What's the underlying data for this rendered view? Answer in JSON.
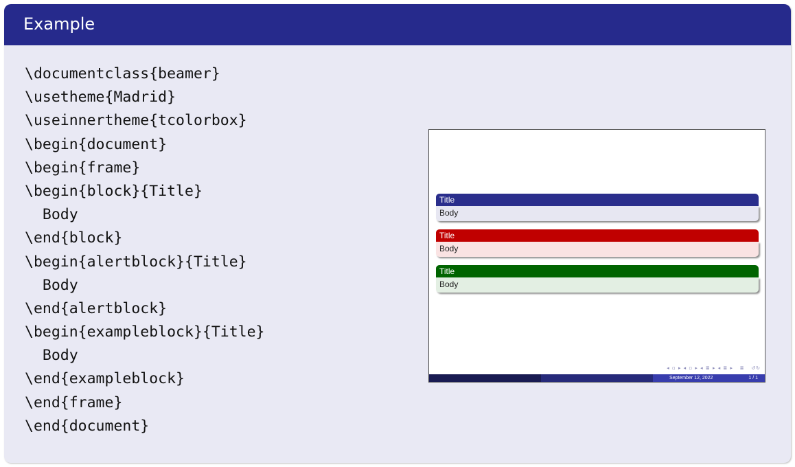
{
  "example": {
    "title": "Example"
  },
  "code_lines": [
    "\\documentclass{beamer}",
    "\\usetheme{Madrid}",
    "\\useinnertheme{tcolorbox}",
    "\\begin{document}",
    "\\begin{frame}",
    "\\begin{block}{Title}",
    "  Body",
    "\\end{block}",
    "\\begin{alertblock}{Title}",
    "  Body",
    "\\end{alertblock}",
    "\\begin{exampleblock}{Title}",
    "  Body",
    "\\end{exampleblock}",
    "\\end{frame}",
    "\\end{document}"
  ],
  "slide": {
    "blocks": [
      {
        "title": "Title",
        "body": "Body",
        "title_color": "#2a2e8c",
        "body_color": "#e7e7f2"
      },
      {
        "title": "Title",
        "body": "Body",
        "title_color": "#c00000",
        "body_color": "#fae3e3"
      },
      {
        "title": "Title",
        "body": "Body",
        "title_color": "#006400",
        "body_color": "#e3efe3"
      }
    ],
    "footer": {
      "date": "September 12, 2022",
      "page": "1 / 1"
    }
  },
  "colors": {
    "header": "#262a8c",
    "box_background": "#e9e9f4"
  }
}
